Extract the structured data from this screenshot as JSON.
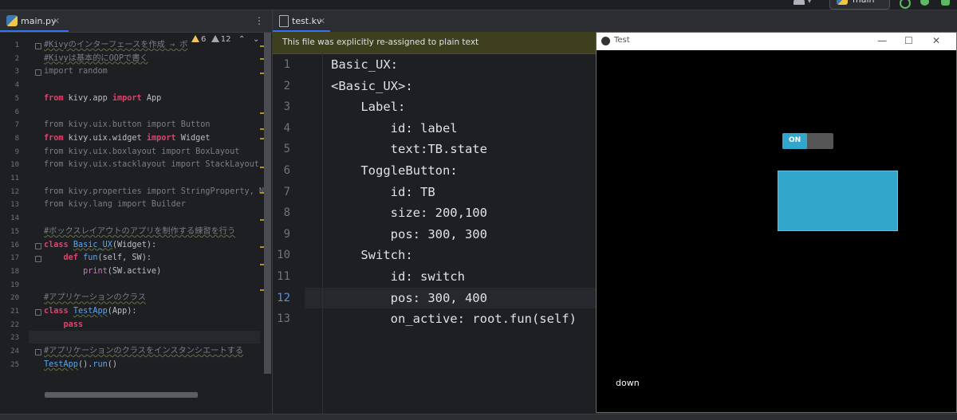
{
  "toolbar": {
    "branch": "main"
  },
  "left_editor": {
    "tab_name": "main.py",
    "tab_close": "✕",
    "menu": "⋮",
    "warnings": {
      "warn_count": "6",
      "weak_count": "12",
      "up": "⌃",
      "down": "⌄"
    },
    "line_numbers": [
      "1",
      "2",
      "3",
      "4",
      "5",
      "6",
      "7",
      "8",
      "9",
      "10",
      "11",
      "12",
      "13",
      "14",
      "15",
      "16",
      "17",
      "18",
      "19",
      "20",
      "21",
      "22",
      "23",
      "24",
      "25"
    ],
    "lines": [
      {
        "parts": [
          {
            "t": "#Kivyのインターフェースを作成 → ボ",
            "c": "cm"
          }
        ]
      },
      {
        "parts": [
          {
            "t": "#Kivyは基本的にOOPで書く",
            "c": "cm"
          }
        ]
      },
      {
        "parts": [
          {
            "t": "import random",
            "c": "dim"
          }
        ]
      },
      {
        "parts": []
      },
      {
        "parts": [
          {
            "t": "from ",
            "c": "kw2"
          },
          {
            "t": "kivy.app ",
            "c": "ok"
          },
          {
            "t": "import ",
            "c": "kw2"
          },
          {
            "t": "App",
            "c": "ok"
          }
        ]
      },
      {
        "parts": []
      },
      {
        "parts": [
          {
            "t": "from kivy.uix.button ",
            "c": "dim"
          },
          {
            "t": "import ",
            "c": "dim"
          },
          {
            "t": "Button",
            "c": "dim"
          }
        ]
      },
      {
        "parts": [
          {
            "t": "from ",
            "c": "kw2"
          },
          {
            "t": "kivy.uix.widget ",
            "c": "ok"
          },
          {
            "t": "import ",
            "c": "kw2"
          },
          {
            "t": "Widget",
            "c": "ok"
          }
        ]
      },
      {
        "parts": [
          {
            "t": "from kivy.uix.boxlayout import BoxLayout",
            "c": "dim"
          }
        ]
      },
      {
        "parts": [
          {
            "t": "from kivy.uix.stacklayout import StackLayout",
            "c": "dim"
          }
        ]
      },
      {
        "parts": []
      },
      {
        "parts": [
          {
            "t": "from kivy.properties import StringProperty, Nu",
            "c": "dim"
          }
        ]
      },
      {
        "parts": [
          {
            "t": "from kivy.lang import Builder",
            "c": "dim"
          }
        ]
      },
      {
        "parts": []
      },
      {
        "parts": [
          {
            "t": "#ボックスレイアウトのアプリを制作する練習を行う",
            "c": "cm"
          }
        ]
      },
      {
        "parts": [
          {
            "t": "class ",
            "c": "kw2"
          },
          {
            "t": "Basic_UX",
            "c": "cls"
          },
          {
            "t": "(Widget):",
            "c": "ok"
          }
        ]
      },
      {
        "parts": [
          {
            "t": "    def ",
            "c": "kw2"
          },
          {
            "t": "fun",
            "c": "fn"
          },
          {
            "t": "(self, ",
            "c": "ok"
          },
          {
            "t": "SW",
            "c": "ok"
          },
          {
            "t": "):",
            "c": "ok"
          }
        ]
      },
      {
        "parts": [
          {
            "t": "        print",
            "c": "bi"
          },
          {
            "t": "(SW.active)",
            "c": "ok"
          }
        ]
      },
      {
        "parts": []
      },
      {
        "parts": [
          {
            "t": "#アプリケーションのクラス",
            "c": "cm"
          }
        ]
      },
      {
        "parts": [
          {
            "t": "class ",
            "c": "kw2"
          },
          {
            "t": "TestApp",
            "c": "cls"
          },
          {
            "t": "(App):",
            "c": "ok"
          }
        ]
      },
      {
        "parts": [
          {
            "t": "    pass",
            "c": "kw2"
          }
        ]
      },
      {
        "parts": []
      },
      {
        "parts": [
          {
            "t": "#アプリケーションのクラスをインスタンシエートする",
            "c": "cm"
          }
        ]
      },
      {
        "parts": [
          {
            "t": "TestApp",
            "c": "cls"
          },
          {
            "t": "().",
            "c": "ok"
          },
          {
            "t": "run",
            "c": "fn"
          },
          {
            "t": "()",
            "c": "ok"
          }
        ]
      }
    ]
  },
  "right_editor": {
    "tab_name": "test.kv",
    "tab_close": "✕",
    "banner": "This file was explicitly re-assigned to plain text",
    "line_numbers": [
      "1",
      "2",
      "3",
      "4",
      "5",
      "6",
      "7",
      "8",
      "9",
      "10",
      "11",
      "12",
      "13"
    ],
    "current_line": "12",
    "lines": [
      "Basic_UX:",
      "<Basic_UX>:",
      "    Label:",
      "        id: label",
      "        text:TB.state",
      "    ToggleButton:",
      "        id: TB",
      "        size: 200,100",
      "        pos: 300, 300",
      "    Switch:",
      "        id: switch",
      "        pos: 300, 400",
      "        on_active: root.fun(self)"
    ]
  },
  "kivy_window": {
    "title": "Test",
    "minimize": "—",
    "maximize": "☐",
    "close": "✕",
    "switch_label": "ON",
    "switch_active": true,
    "label_text": "down"
  },
  "colors": {
    "accent": "#33a6cc",
    "keyword": "#d8456e",
    "banner_bg": "#3d3f1e"
  }
}
